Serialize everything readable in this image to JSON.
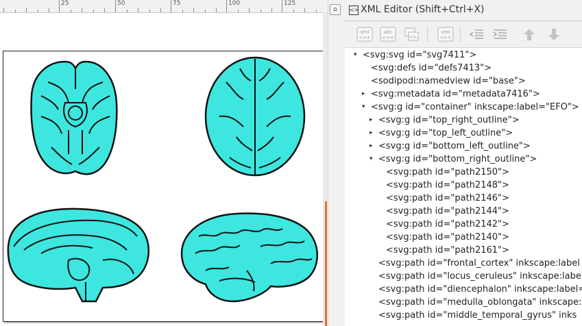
{
  "ruler": {
    "labels": [
      "25",
      "50",
      "75",
      "100",
      "125"
    ]
  },
  "panel": {
    "title": "XML Editor (Shift+Ctrl+X)",
    "toolbar": {
      "new_element_label": "xml",
      "new_text_label": "abc",
      "delete_node_label": "xml"
    }
  },
  "tree": {
    "rows": [
      {
        "text": "<svg:svg id=\"svg7411\">",
        "arrow": "▾"
      },
      {
        "text": "<svg:defs id=\"defs7413\">",
        "arrow": ""
      },
      {
        "text": "<sodipodi:namedview id=\"base\">",
        "arrow": ""
      },
      {
        "text": "<svg:metadata id=\"metadata7416\">",
        "arrow": "▸"
      },
      {
        "text": "<svg:g id=\"container\" inkscape:label=\"EFO\">",
        "arrow": "▾"
      },
      {
        "text": "<svg:g id=\"top_right_outline\">",
        "arrow": "▸"
      },
      {
        "text": "<svg:g id=\"top_left_outline\">",
        "arrow": "▸"
      },
      {
        "text": "<svg:g id=\"bottom_left_outline\">",
        "arrow": "▸"
      },
      {
        "text": "<svg:g id=\"bottom_right_outline\">",
        "arrow": "▾"
      },
      {
        "text": "<svg:path id=\"path2150\">",
        "arrow": ""
      },
      {
        "text": "<svg:path id=\"path2148\">",
        "arrow": ""
      },
      {
        "text": "<svg:path id=\"path2146\">",
        "arrow": ""
      },
      {
        "text": "<svg:path id=\"path2144\">",
        "arrow": ""
      },
      {
        "text": "<svg:path id=\"path2142\">",
        "arrow": ""
      },
      {
        "text": "<svg:path id=\"path2140\">",
        "arrow": ""
      },
      {
        "text": "<svg:path id=\"path2161\">",
        "arrow": ""
      },
      {
        "text": "<svg:path id=\"frontal_cortex\" inkscape:label",
        "arrow": ""
      },
      {
        "text": "<svg:path id=\"locus_ceruleus\" inkscape:label",
        "arrow": ""
      },
      {
        "text": "<svg:path id=\"diencephalon\" inkscape:label=",
        "arrow": ""
      },
      {
        "text": "<svg:path id=\"medulla_oblongata\" inkscape:",
        "arrow": ""
      },
      {
        "text": "<svg:path id=\"middle_temporal_gyrus\" inks",
        "arrow": ""
      }
    ]
  },
  "colors": {
    "brain_fill": "#3de6de",
    "outline": "#111111",
    "scroll_accent": "#e2722e"
  }
}
